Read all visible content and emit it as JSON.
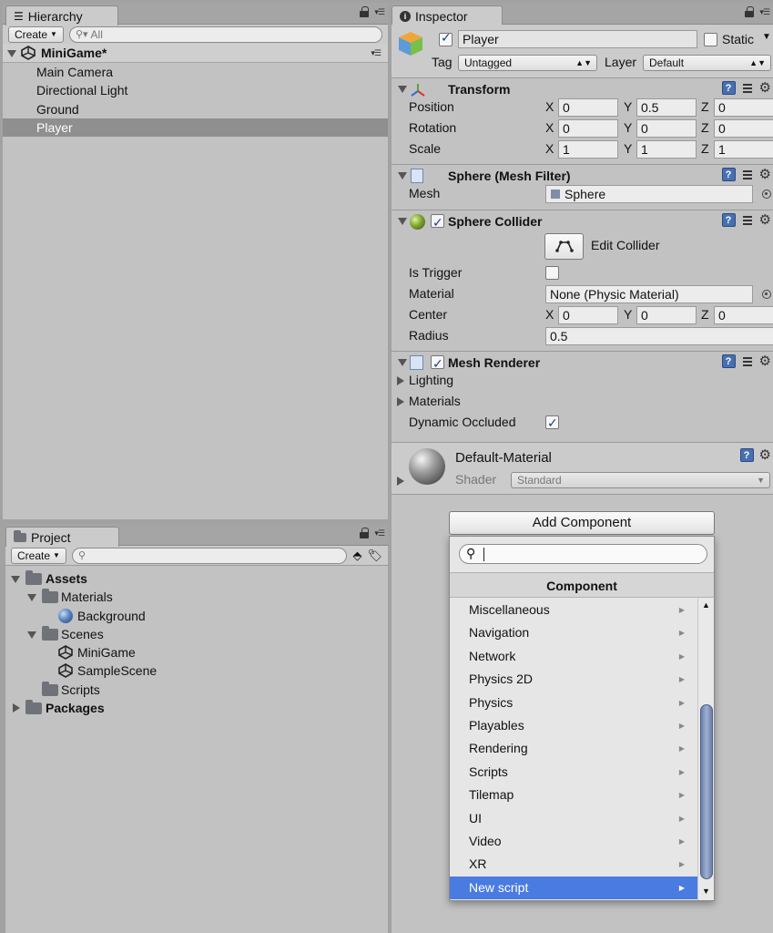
{
  "hierarchy": {
    "tab_label": "Hierarchy",
    "create_label": "Create",
    "search_placeholder": "All",
    "scene_name": "MiniGame*",
    "items": [
      "Main Camera",
      "Directional Light",
      "Ground",
      "Player"
    ],
    "selected": "Player"
  },
  "project": {
    "tab_label": "Project",
    "create_label": "Create",
    "tree": {
      "assets": "Assets",
      "materials": "Materials",
      "background": "Background",
      "scenes": "Scenes",
      "minigame": "MiniGame",
      "samplescene": "SampleScene",
      "scripts": "Scripts",
      "packages": "Packages"
    }
  },
  "inspector": {
    "tab_label": "Inspector",
    "object_name": "Player",
    "static_label": "Static",
    "tag_label": "Tag",
    "tag_value": "Untagged",
    "layer_label": "Layer",
    "layer_value": "Default",
    "transform": {
      "title": "Transform",
      "position_label": "Position",
      "rotation_label": "Rotation",
      "scale_label": "Scale",
      "position": {
        "x": "0",
        "y": "0.5",
        "z": "0"
      },
      "rotation": {
        "x": "0",
        "y": "0",
        "z": "0"
      },
      "scale": {
        "x": "1",
        "y": "1",
        "z": "1"
      }
    },
    "mesh_filter": {
      "title": "Sphere (Mesh Filter)",
      "mesh_label": "Mesh",
      "mesh_value": "Sphere"
    },
    "sphere_collider": {
      "title": "Sphere Collider",
      "edit_label": "Edit Collider",
      "is_trigger_label": "Is Trigger",
      "material_label": "Material",
      "material_value": "None (Physic Material)",
      "center_label": "Center",
      "center": {
        "x": "0",
        "y": "0",
        "z": "0"
      },
      "radius_label": "Radius",
      "radius_value": "0.5"
    },
    "mesh_renderer": {
      "title": "Mesh Renderer",
      "lighting_label": "Lighting",
      "materials_label": "Materials",
      "dynamic_occluded_label": "Dynamic Occluded"
    },
    "material": {
      "name": "Default-Material",
      "shader_label": "Shader",
      "shader_value": "Standard"
    },
    "axis": {
      "x": "X",
      "y": "Y",
      "z": "Z"
    },
    "add_component_label": "Add Component"
  },
  "component_popup": {
    "header": "Component",
    "items": [
      "Miscellaneous",
      "Navigation",
      "Network",
      "Physics 2D",
      "Physics",
      "Playables",
      "Rendering",
      "Scripts",
      "Tilemap",
      "UI",
      "Video",
      "XR",
      "New script"
    ],
    "selected": "New script"
  }
}
